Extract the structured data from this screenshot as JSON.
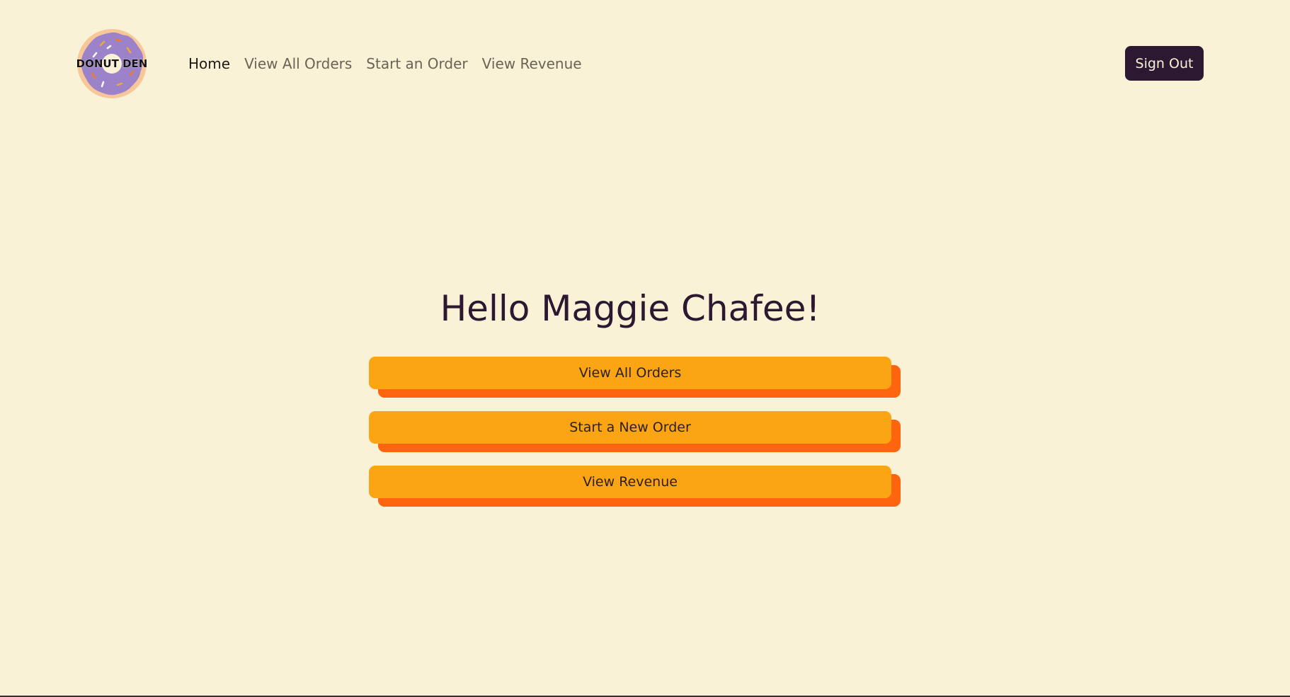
{
  "brand": {
    "logo_text": "DONUT DEN",
    "logo_icon": "donut-logo-icon",
    "frosting_color": "#9b82c9",
    "dough_color": "#f7c79a"
  },
  "nav": {
    "items": [
      {
        "label": "Home",
        "active": true
      },
      {
        "label": "View All Orders",
        "active": false
      },
      {
        "label": "Start an Order",
        "active": false
      },
      {
        "label": "View Revenue",
        "active": false
      }
    ],
    "sign_out_label": "Sign Out"
  },
  "main": {
    "greeting": "Hello Maggie Chafee!",
    "actions": [
      {
        "label": "View All Orders"
      },
      {
        "label": "Start a New Order"
      },
      {
        "label": "View Revenue"
      }
    ]
  },
  "colors": {
    "background": "#faf2d6",
    "primary_dark": "#2d1832",
    "button_fill": "#fba515",
    "button_shadow": "#ff640e"
  }
}
